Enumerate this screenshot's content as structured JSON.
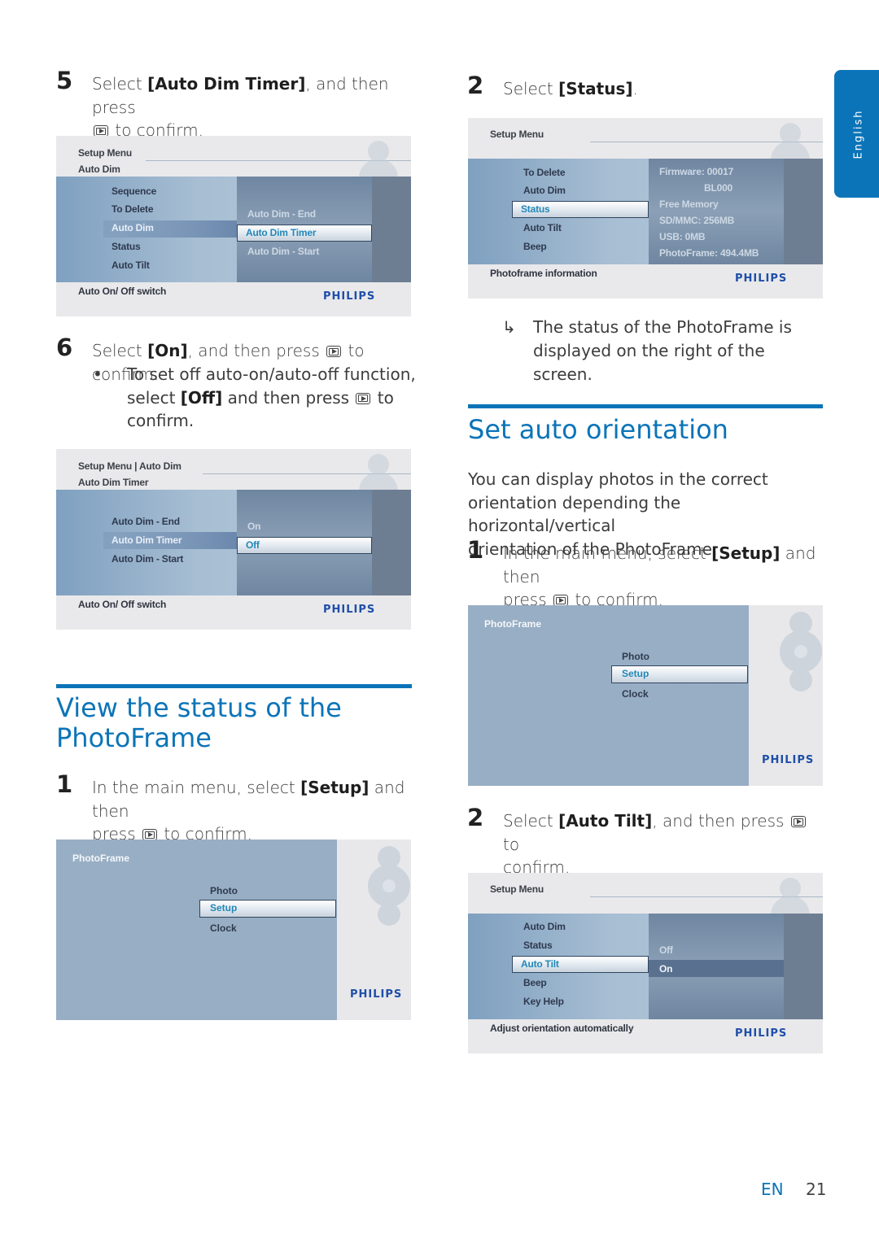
{
  "language_tab": "English",
  "confirm_icon": "play-confirm-button-icon",
  "left_column": {
    "step5": {
      "number": "5",
      "pre": "Select ",
      "bold": "[Auto Dim Timer]",
      "post": ", and then press",
      "line2": " to confirm."
    },
    "screen1": {
      "header1": "Setup Menu",
      "header2": "Auto Dim",
      "left_items": [
        "Sequence",
        "To Delete",
        "Auto Dim",
        "Status",
        "Auto Tilt"
      ],
      "left_active": "Auto Dim",
      "right_items": [
        "Auto Dim - End",
        "Auto Dim Timer",
        "Auto Dim - Start"
      ],
      "right_selected": "Auto Dim Timer",
      "footer": "Auto On/ Off switch",
      "brand": "PHILIPS"
    },
    "step6": {
      "number": "6",
      "pre": "Select ",
      "bold": "[On]",
      "post": ", and then press",
      "post2": " to confirm.",
      "bullet_dot": "•",
      "bullet_line1": "To set off auto-on/auto-off function,",
      "bullet_pre": "select ",
      "bullet_bold": "[Off]",
      "bullet_post": " and then press",
      "bullet_post2": " to",
      "bullet_line3": "confirm."
    },
    "screen2": {
      "header1": "Setup Menu | Auto Dim",
      "header2": "Auto Dim Timer",
      "left_items": [
        "Auto Dim - End",
        "Auto Dim Timer",
        "Auto Dim - Start"
      ],
      "left_active": "Auto Dim Timer",
      "right_items": [
        "On",
        "Off"
      ],
      "right_selected": "Off",
      "footer": "Auto On/ Off switch",
      "brand": "PHILIPS"
    },
    "section": {
      "title_line1": "View the status of the",
      "title_line2": "PhotoFrame"
    },
    "step1": {
      "number": "1",
      "pre": "In the main menu, select ",
      "bold": "[Setup]",
      "post": " and then",
      "line2_pre": "press",
      "line2_post": " to confirm."
    },
    "screen3": {
      "title": "PhotoFrame",
      "items": [
        "Photo",
        "Setup",
        "Clock"
      ],
      "selected": "Setup",
      "brand": "PHILIPS"
    }
  },
  "right_column": {
    "step2": {
      "number": "2",
      "pre": "Select ",
      "bold": "[Status]",
      "post": "."
    },
    "screen4": {
      "header1": "Setup Menu",
      "left_items": [
        "To Delete",
        "Auto Dim",
        "Status",
        "Auto Tilt",
        "Beep"
      ],
      "left_selected": "Status",
      "status_info": [
        "Firmware:  00017",
        "BL000",
        "Free Memory",
        "SD/MMC:  256MB",
        "USB:   0MB",
        "PhotoFrame: 494.4MB"
      ],
      "footer": "Photoframe information",
      "brand": "PHILIPS"
    },
    "result": {
      "arrow": "↳",
      "line1": "The status of the PhotoFrame is",
      "line2": "displayed on the right of the screen."
    },
    "section": {
      "title": "Set auto orientation"
    },
    "intro": {
      "line1": "You can display photos in the correct",
      "line2": "orientation depending the horizontal/vertical",
      "line3": "orientation of the PhotoFrame."
    },
    "step1": {
      "number": "1",
      "pre": "In the main menu, select ",
      "bold": "[Setup]",
      "post": " and then",
      "line2_pre": "press",
      "line2_post": " to confirm."
    },
    "screen5": {
      "title": "PhotoFrame",
      "items": [
        "Photo",
        "Setup",
        "Clock"
      ],
      "selected": "Setup",
      "brand": "PHILIPS"
    },
    "step2b": {
      "number": "2",
      "pre": "Select ",
      "bold": "[Auto Tilt]",
      "post": ", and then press",
      "post2": " to",
      "line2": "confirm."
    },
    "screen6": {
      "header1": "Setup Menu",
      "left_items": [
        "Auto Dim",
        "Status",
        "Auto Tilt",
        "Beep",
        "Key Help"
      ],
      "left_selected": "Auto Tilt",
      "right_items": [
        "Off",
        "On"
      ],
      "right_active": "On",
      "footer": "Adjust orientation automatically",
      "brand": "PHILIPS"
    }
  },
  "footer": {
    "lang": "EN",
    "page": "21"
  }
}
